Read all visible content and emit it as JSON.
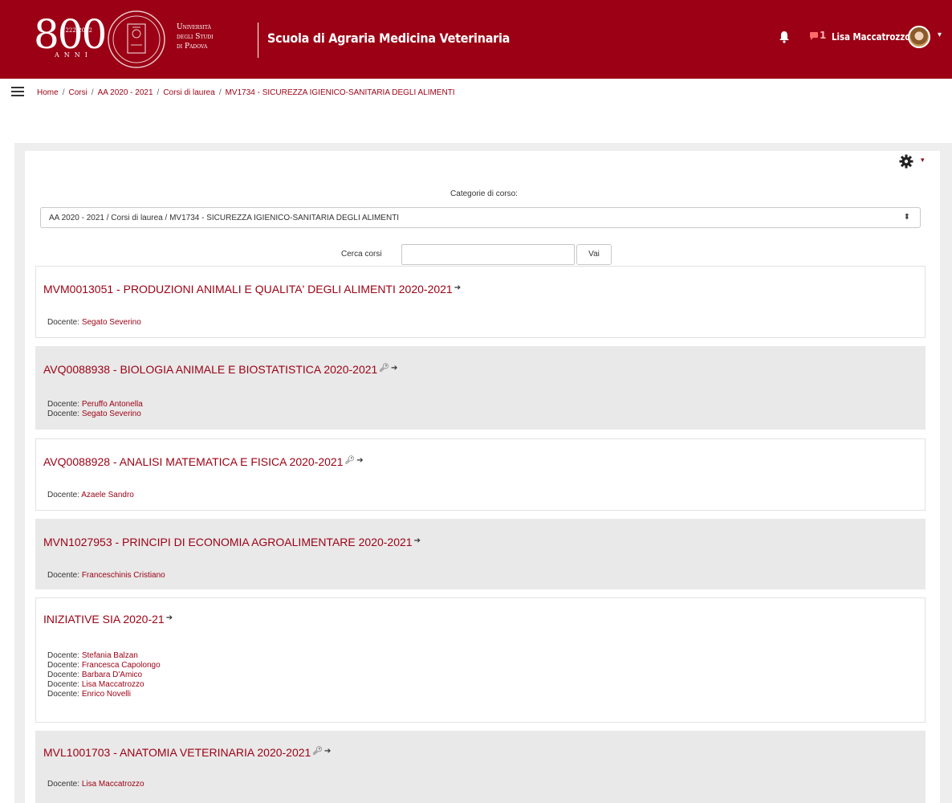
{
  "header": {
    "logo_years": "1222-2022",
    "logo_big": "800",
    "logo_anni": "ANNI",
    "university_lines": [
      "Università",
      "degli Studi",
      "di Padova"
    ],
    "school_name": "Scuola di Agraria Medicina Veterinaria",
    "messages_count": "1",
    "username": "Lisa Maccatrozzo",
    "brand_color": "#9b0014"
  },
  "breadcrumb": [
    "Home",
    "Corsi",
    "AA 2020 - 2021",
    "Corsi di laurea",
    "MV1734 - SICUREZZA IGIENICO-SANITARIA DEGLI ALIMENTI"
  ],
  "filters": {
    "category_label": "Categorie di corso:",
    "category_selected": "AA 2020 - 2021 / Corsi di laurea / MV1734 - SICUREZZA IGIENICO-SANITARIA DEGLI ALIMENTI",
    "search_label": "Cerca corsi",
    "search_value": "",
    "search_button": "Vai"
  },
  "teacher_label": "Docente: ",
  "courses": [
    {
      "title": "MVM0013051 - PRODUZIONI ANIMALI E QUALITA' DEGLI ALIMENTI 2020-2021",
      "key_icon": false,
      "teachers": [
        "Segato Severino"
      ]
    },
    {
      "title": "AVQ0088938 - BIOLOGIA ANIMALE E BIOSTATISTICA 2020-2021",
      "key_icon": true,
      "teachers": [
        "Peruffo Antonella",
        "Segato Severino"
      ]
    },
    {
      "title": "AVQ0088928 - ANALISI MATEMATICA E FISICA 2020-2021",
      "key_icon": true,
      "teachers": [
        "Azaele Sandro"
      ]
    },
    {
      "title": "MVN1027953 - PRINCIPI DI ECONOMIA AGROALIMENTARE 2020-2021",
      "key_icon": false,
      "teachers": [
        "Franceschinis Cristiano"
      ]
    },
    {
      "title": "INIZIATIVE SIA 2020-21",
      "key_icon": false,
      "teachers": [
        "Stefania Balzan",
        "Francesca Capolongo",
        "Barbara D'Amico",
        "Lisa Maccatrozzo",
        "Enrico Novelli"
      ]
    },
    {
      "title": "MVL1001703 - ANATOMIA VETERINARIA 2020-2021",
      "key_icon": true,
      "teachers": [
        "Lisa Maccatrozzo"
      ]
    }
  ]
}
